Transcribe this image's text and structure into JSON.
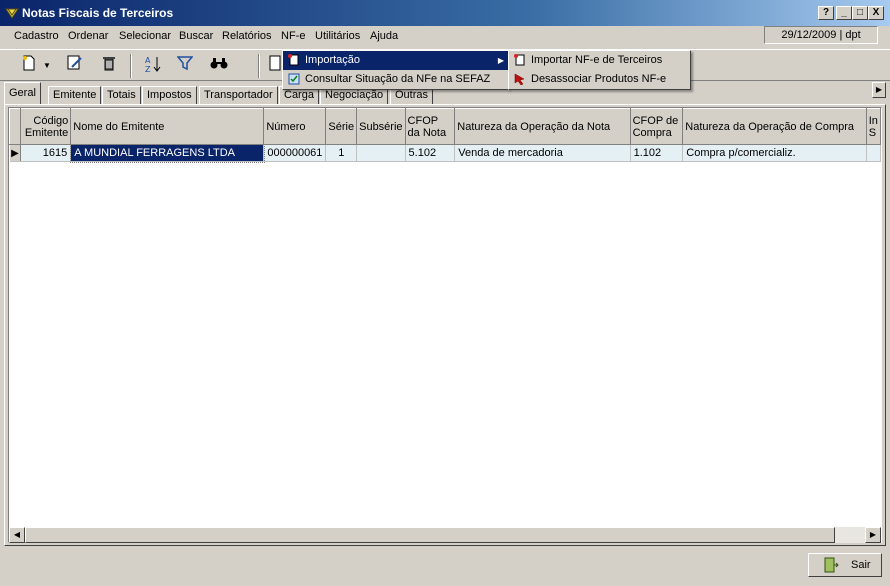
{
  "window": {
    "title": "Notas Fiscais de Terceiros",
    "buttons": [
      "?",
      "_",
      "□",
      "X"
    ]
  },
  "menubar": {
    "items": [
      "Cadastro",
      "Ordenar",
      "Selecionar",
      "Buscar",
      "Relatórios",
      "NF-e",
      "Utilitários",
      "Ajuda"
    ],
    "status": "29/12/2009 | dpt"
  },
  "nfe_menu": {
    "items": [
      "Importação",
      "Consultar Situação da NFe na SEFAZ"
    ]
  },
  "importacao_submenu": {
    "items": [
      "Importar NF-e de Terceiros",
      "Desassociar Produtos NF-e"
    ]
  },
  "tabs": [
    "Geral",
    "Emitente",
    "Totais",
    "Impostos",
    "Transportador",
    "Carga",
    "Negociação",
    "Outras"
  ],
  "grid": {
    "columns": [
      "Código Emitente",
      "Nome do Emitente",
      "Número",
      "Série",
      "Subsérie",
      "CFOP da Nota",
      "Natureza da Operação da Nota",
      "CFOP de Compra",
      "Natureza da Operação de Compra",
      "In S"
    ],
    "rows": [
      [
        "1615",
        "A MUNDIAL FERRAGENS LTDA",
        "000000061",
        "1",
        "",
        "5.102",
        "Venda de mercadoria",
        "1.102",
        "Compra p/comercializ.",
        ""
      ]
    ]
  },
  "footer": {
    "exit_label": "Sair"
  }
}
